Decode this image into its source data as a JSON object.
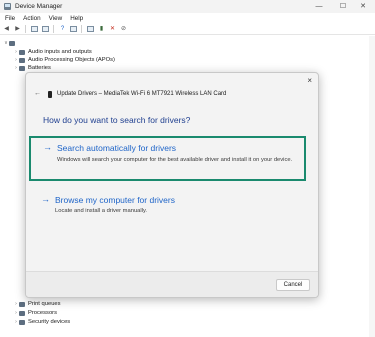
{
  "window": {
    "title": "Device Manager",
    "controls": {
      "minimize": "—",
      "maximize": "☐",
      "close": "✕"
    }
  },
  "menu": [
    "File",
    "Action",
    "View",
    "Help"
  ],
  "toolbar": [
    "back-arrow-icon",
    "forward-arrow-icon",
    "properties-icon",
    "list-icon",
    "help-icon",
    "view-icon",
    "scan-icon",
    "update-driver-icon",
    "uninstall-icon",
    "disable-icon"
  ],
  "tree": {
    "root_chevron": "∨",
    "items_top": [
      {
        "label": "Audio inputs and outputs"
      },
      {
        "label": "Audio Processing Objects (APOs)"
      },
      {
        "label": "Batteries"
      }
    ],
    "items_bottom": [
      {
        "label": "Print queues"
      },
      {
        "label": "Processors"
      },
      {
        "label": "Security devices"
      }
    ]
  },
  "dialog": {
    "header": "Update Drivers – MediaTek Wi-Fi 6 MT7921 Wireless LAN Card",
    "question": "How do you want to search for drivers?",
    "option_auto": {
      "arrow": "→",
      "title": "Search automatically for drivers",
      "description": "Windows will search your computer for the best available driver and install it on your device."
    },
    "option_browse": {
      "arrow": "→",
      "title": "Browse my computer for drivers",
      "description": "Locate and install a driver manually."
    },
    "close": "×",
    "back": "←",
    "cancel_label": "Cancel"
  },
  "colors": {
    "accent_link": "#1e64c8",
    "focus_border": "#1a8a6e"
  }
}
